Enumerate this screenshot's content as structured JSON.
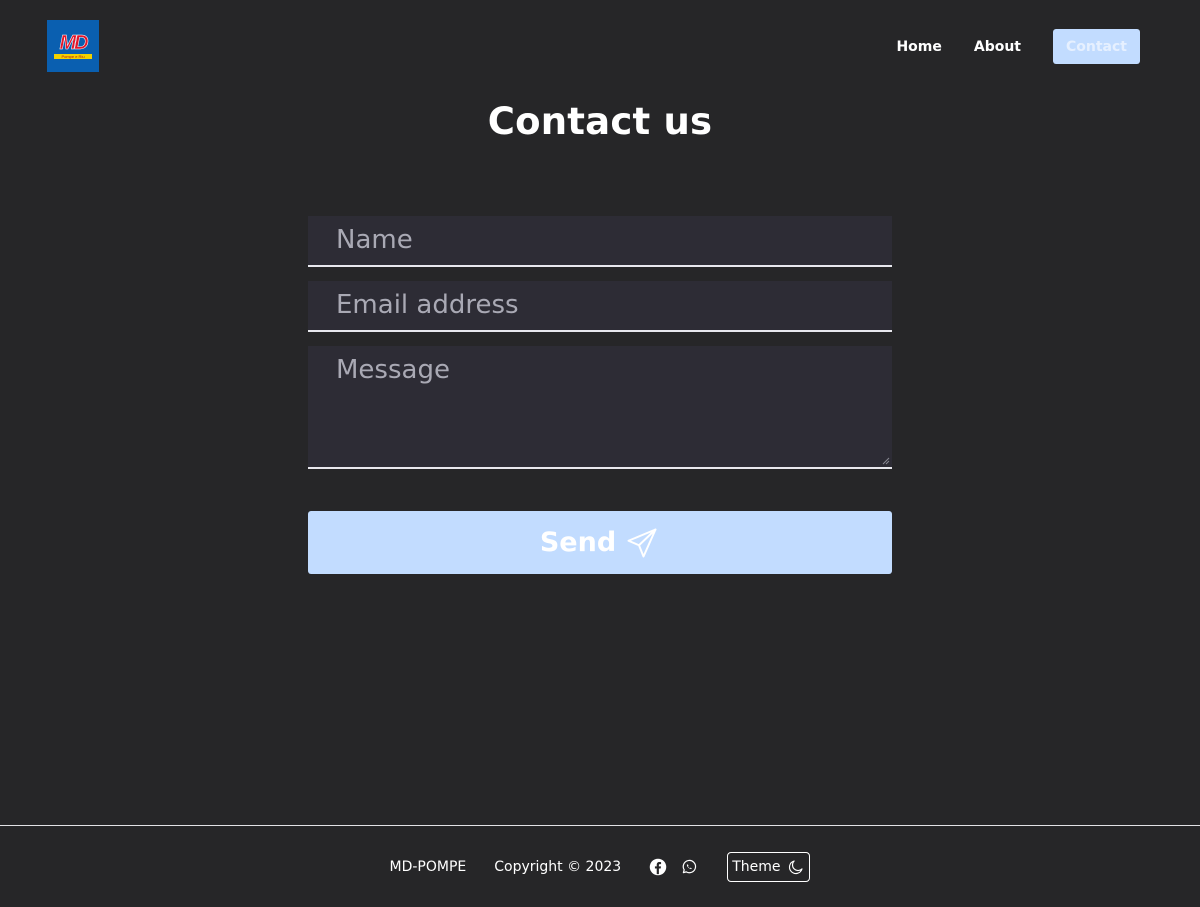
{
  "logo": {
    "mark": "MD",
    "tagline": "Pompe e Riu"
  },
  "nav": {
    "items": [
      {
        "label": "Home"
      },
      {
        "label": "About"
      },
      {
        "label": "Contact"
      }
    ],
    "active": "Contact"
  },
  "page": {
    "title": "Contact us"
  },
  "form": {
    "name_placeholder": "Name",
    "email_placeholder": "Email address",
    "message_placeholder": "Message",
    "send_label": "Send",
    "send_icon": "paper-plane-icon"
  },
  "footer": {
    "brand": "MD-POMPE",
    "copyright": "Copyright © 2023",
    "social": [
      "facebook-icon",
      "whatsapp-icon"
    ],
    "theme_label": "Theme",
    "theme_icon": "moon-icon"
  },
  "colors": {
    "background": "#262628",
    "accent": "#c2dcff",
    "field_bg": "#2d2c35",
    "logo_bg": "#0a5fb0"
  }
}
